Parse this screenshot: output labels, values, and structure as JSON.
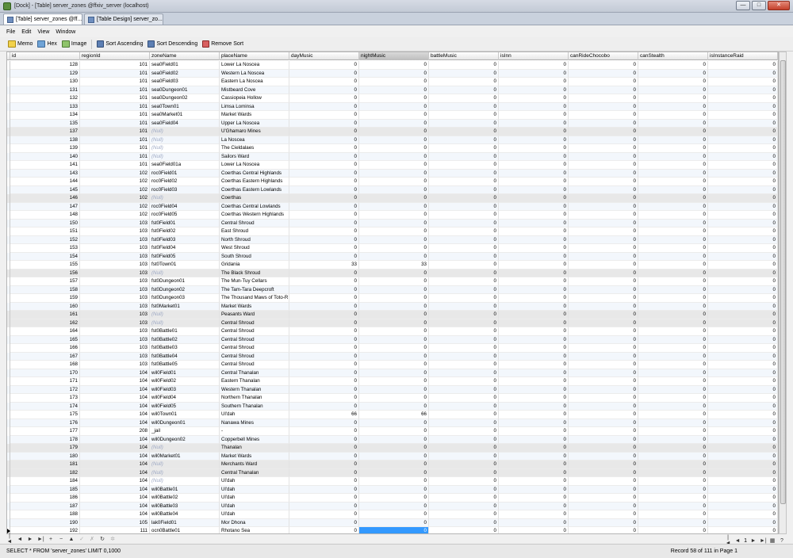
{
  "window": {
    "title": "[Dock] - [Table] server_zones @ffxiv_server (localhost)",
    "controls": {
      "minimize": "—",
      "maximize": "□",
      "close": "✕"
    }
  },
  "tabs": [
    {
      "label": "[Table] server_zones @ff...",
      "active": true
    },
    {
      "label": "[Table Design] server_zo...",
      "active": false
    }
  ],
  "menu": [
    "File",
    "Edit",
    "View",
    "Window"
  ],
  "toolbar": {
    "memo": "Memo",
    "hex": "Hex",
    "image": "Image",
    "sort_asc": "Sort Ascending",
    "sort_desc": "Sort Descending",
    "remove_sort": "Remove Sort"
  },
  "grid": {
    "columns": [
      "id",
      "regionId",
      "zoneName",
      "placeName",
      "dayMusic",
      "nightMusic",
      "battleMusic",
      "isInn",
      "canRideChocobo",
      "canStealth",
      "isInstanceRaid"
    ],
    "selected_column": "nightMusic",
    "rows": [
      [
        "128",
        "101",
        "sea0Field01",
        "Lower La Noscea",
        "0",
        "0",
        "0",
        "0",
        "0",
        "0",
        "0"
      ],
      [
        "129",
        "101",
        "sea0Field02",
        "Western La Noscea",
        "0",
        "0",
        "0",
        "0",
        "0",
        "0",
        "0"
      ],
      [
        "130",
        "101",
        "sea0Field03",
        "Eastern La Noscea",
        "0",
        "0",
        "0",
        "0",
        "0",
        "0",
        "0"
      ],
      [
        "131",
        "101",
        "sea0Dungeon01",
        "Mistbeard Cove",
        "0",
        "0",
        "0",
        "0",
        "0",
        "0",
        "0"
      ],
      [
        "132",
        "101",
        "sea0Dungeon02",
        "Cassiopeia Hollow",
        "0",
        "0",
        "0",
        "0",
        "0",
        "0",
        "0"
      ],
      [
        "133",
        "101",
        "sea0Town01",
        "Limsa Lominsa",
        "0",
        "0",
        "0",
        "0",
        "0",
        "0",
        "0"
      ],
      [
        "134",
        "101",
        "sea0Market01",
        "Market Wards",
        "0",
        "0",
        "0",
        "0",
        "0",
        "0",
        "0"
      ],
      [
        "135",
        "101",
        "sea0Field04",
        "Upper La Noscea",
        "0",
        "0",
        "0",
        "0",
        "0",
        "0",
        "0"
      ],
      [
        "137",
        "101",
        "(Null)",
        "U'Ghamaro Mines",
        "0",
        "0",
        "0",
        "0",
        "0",
        "0",
        "0"
      ],
      [
        "138",
        "101",
        "(Null)",
        "La Noscea",
        "0",
        "0",
        "0",
        "0",
        "0",
        "0",
        "0"
      ],
      [
        "139",
        "101",
        "(Null)",
        "The Cieldalaes",
        "0",
        "0",
        "0",
        "0",
        "0",
        "0",
        "0"
      ],
      [
        "140",
        "101",
        "(Null)",
        "Sailors Ward",
        "0",
        "0",
        "0",
        "0",
        "0",
        "0",
        "0"
      ],
      [
        "141",
        "101",
        "sea0Field01a",
        "Lower La Noscea",
        "0",
        "0",
        "0",
        "0",
        "0",
        "0",
        "0"
      ],
      [
        "143",
        "102",
        "roc0Field01",
        "Coerthas Central Highlands",
        "0",
        "0",
        "0",
        "0",
        "0",
        "0",
        "0"
      ],
      [
        "144",
        "102",
        "roc0Field02",
        "Coerthas Eastern Highlands",
        "0",
        "0",
        "0",
        "0",
        "0",
        "0",
        "0"
      ],
      [
        "145",
        "102",
        "roc0Field03",
        "Coerthas Eastern Lowlands",
        "0",
        "0",
        "0",
        "0",
        "0",
        "0",
        "0"
      ],
      [
        "146",
        "102",
        "(Null)",
        "Coerthas",
        "0",
        "0",
        "0",
        "0",
        "0",
        "0",
        "0"
      ],
      [
        "147",
        "102",
        "roc0Field04",
        "Coerthas Central Lowlands",
        "0",
        "0",
        "0",
        "0",
        "0",
        "0",
        "0"
      ],
      [
        "148",
        "102",
        "roc0Field05",
        "Coerthas Western Highlands",
        "0",
        "0",
        "0",
        "0",
        "0",
        "0",
        "0"
      ],
      [
        "150",
        "103",
        "fst0Field01",
        "Central Shroud",
        "0",
        "0",
        "0",
        "0",
        "0",
        "0",
        "0"
      ],
      [
        "151",
        "103",
        "fst0Field02",
        "East Shroud",
        "0",
        "0",
        "0",
        "0",
        "0",
        "0",
        "0"
      ],
      [
        "152",
        "103",
        "fst0Field03",
        "North Shroud",
        "0",
        "0",
        "0",
        "0",
        "0",
        "0",
        "0"
      ],
      [
        "153",
        "103",
        "fst0Field04",
        "West Shroud",
        "0",
        "0",
        "0",
        "0",
        "0",
        "0",
        "0"
      ],
      [
        "154",
        "103",
        "fst0Field05",
        "South Shroud",
        "0",
        "0",
        "0",
        "0",
        "0",
        "0",
        "0"
      ],
      [
        "155",
        "103",
        "fst0Town01",
        "Gridania",
        "33",
        "33",
        "0",
        "0",
        "0",
        "0",
        "0"
      ],
      [
        "156",
        "103",
        "(Null)",
        "The Black Shroud",
        "0",
        "0",
        "0",
        "0",
        "0",
        "0",
        "0"
      ],
      [
        "157",
        "103",
        "fst0Dungeon01",
        "The Mun-Tuy Cellars",
        "0",
        "0",
        "0",
        "0",
        "0",
        "0",
        "0"
      ],
      [
        "158",
        "103",
        "fst0Dungeon02",
        "The Tam-Tara Deepcroft",
        "0",
        "0",
        "0",
        "0",
        "0",
        "0",
        "0"
      ],
      [
        "159",
        "103",
        "fst0Dungeon03",
        "The Thousand Maws of Toto-R",
        "0",
        "0",
        "0",
        "0",
        "0",
        "0",
        "0"
      ],
      [
        "160",
        "103",
        "fst0Market01",
        "Market Wards",
        "0",
        "0",
        "0",
        "0",
        "0",
        "0",
        "0"
      ],
      [
        "161",
        "103",
        "(Null)",
        "Peasants Ward",
        "0",
        "0",
        "0",
        "0",
        "0",
        "0",
        "0"
      ],
      [
        "162",
        "103",
        "(Null)",
        "Central Shroud",
        "0",
        "0",
        "0",
        "0",
        "0",
        "0",
        "0"
      ],
      [
        "164",
        "103",
        "fst0Battle01",
        "Central Shroud",
        "0",
        "0",
        "0",
        "0",
        "0",
        "0",
        "0"
      ],
      [
        "165",
        "103",
        "fst0Battle02",
        "Central Shroud",
        "0",
        "0",
        "0",
        "0",
        "0",
        "0",
        "0"
      ],
      [
        "166",
        "103",
        "fst0Battle03",
        "Central Shroud",
        "0",
        "0",
        "0",
        "0",
        "0",
        "0",
        "0"
      ],
      [
        "167",
        "103",
        "fst0Battle04",
        "Central Shroud",
        "0",
        "0",
        "0",
        "0",
        "0",
        "0",
        "0"
      ],
      [
        "168",
        "103",
        "fst0Battle05",
        "Central Shroud",
        "0",
        "0",
        "0",
        "0",
        "0",
        "0",
        "0"
      ],
      [
        "170",
        "104",
        "wil0Field01",
        "Central Thanalan",
        "0",
        "0",
        "0",
        "0",
        "0",
        "0",
        "0"
      ],
      [
        "171",
        "104",
        "wil0Field02",
        "Eastern Thanalan",
        "0",
        "0",
        "0",
        "0",
        "0",
        "0",
        "0"
      ],
      [
        "172",
        "104",
        "wil0Field03",
        "Western Thanalan",
        "0",
        "0",
        "0",
        "0",
        "0",
        "0",
        "0"
      ],
      [
        "173",
        "104",
        "wil0Field04",
        "Northern Thanalan",
        "0",
        "0",
        "0",
        "0",
        "0",
        "0",
        "0"
      ],
      [
        "174",
        "104",
        "wil0Field05",
        "Southern Thanalan",
        "0",
        "0",
        "0",
        "0",
        "0",
        "0",
        "0"
      ],
      [
        "175",
        "104",
        "wil0Town01",
        "Ul'dah",
        "66",
        "66",
        "0",
        "0",
        "0",
        "0",
        "0"
      ],
      [
        "176",
        "104",
        "wil0Dungeon01",
        "Nanawa Mines",
        "0",
        "0",
        "0",
        "0",
        "0",
        "0",
        "0"
      ],
      [
        "177",
        "208",
        "_jail",
        "-",
        "0",
        "0",
        "0",
        "0",
        "0",
        "0",
        "0"
      ],
      [
        "178",
        "104",
        "wil0Dungeon02",
        "Copperbell Mines",
        "0",
        "0",
        "0",
        "0",
        "0",
        "0",
        "0"
      ],
      [
        "179",
        "104",
        "(Null)",
        "Thanalan",
        "0",
        "0",
        "0",
        "0",
        "0",
        "0",
        "0"
      ],
      [
        "180",
        "104",
        "wil0Market01",
        "Market Wards",
        "0",
        "0",
        "0",
        "0",
        "0",
        "0",
        "0"
      ],
      [
        "181",
        "104",
        "(Null)",
        "Merchants Ward",
        "0",
        "0",
        "0",
        "0",
        "0",
        "0",
        "0"
      ],
      [
        "182",
        "104",
        "(Null)",
        "Central Thanalan",
        "0",
        "0",
        "0",
        "0",
        "0",
        "0",
        "0"
      ],
      [
        "184",
        "104",
        "(Null)",
        "Ul'dah",
        "0",
        "0",
        "0",
        "0",
        "0",
        "0",
        "0"
      ],
      [
        "185",
        "104",
        "wil0Battle01",
        "Ul'dah",
        "0",
        "0",
        "0",
        "0",
        "0",
        "0",
        "0"
      ],
      [
        "186",
        "104",
        "wil0Battle02",
        "Ul'dah",
        "0",
        "0",
        "0",
        "0",
        "0",
        "0",
        "0"
      ],
      [
        "187",
        "104",
        "wil0Battle03",
        "Ul'dah",
        "0",
        "0",
        "0",
        "0",
        "0",
        "0",
        "0"
      ],
      [
        "188",
        "104",
        "wil0Battle04",
        "Ul'dah",
        "0",
        "0",
        "0",
        "0",
        "0",
        "0",
        "0"
      ],
      [
        "190",
        "105",
        "lak0Field01",
        "Mor Dhona",
        "0",
        "0",
        "0",
        "0",
        "0",
        "0",
        "0"
      ],
      [
        "192",
        "111",
        "ocn0Battle01",
        "Rhotano Sea",
        "0",
        "0",
        "0",
        "0",
        "0",
        "0",
        "0"
      ]
    ],
    "current_row_index": 56,
    "selected_cell_col": 5
  },
  "navigator": {
    "buttons": [
      "first-record",
      "prev-record",
      "next-record",
      "last-record",
      "add-record",
      "delete-record",
      "move-up",
      "apply",
      "cancel",
      "refresh",
      "stop"
    ],
    "glyphs": [
      "|◄",
      "◄",
      "►",
      "►|",
      "+",
      "−",
      "▲",
      "✓",
      "✗",
      "↻",
      "✲"
    ],
    "page": "1"
  },
  "status": {
    "sql": "SELECT * FROM 'server_zones' LIMIT 0,1000",
    "record": "Record 58 of 111 in Page 1"
  }
}
